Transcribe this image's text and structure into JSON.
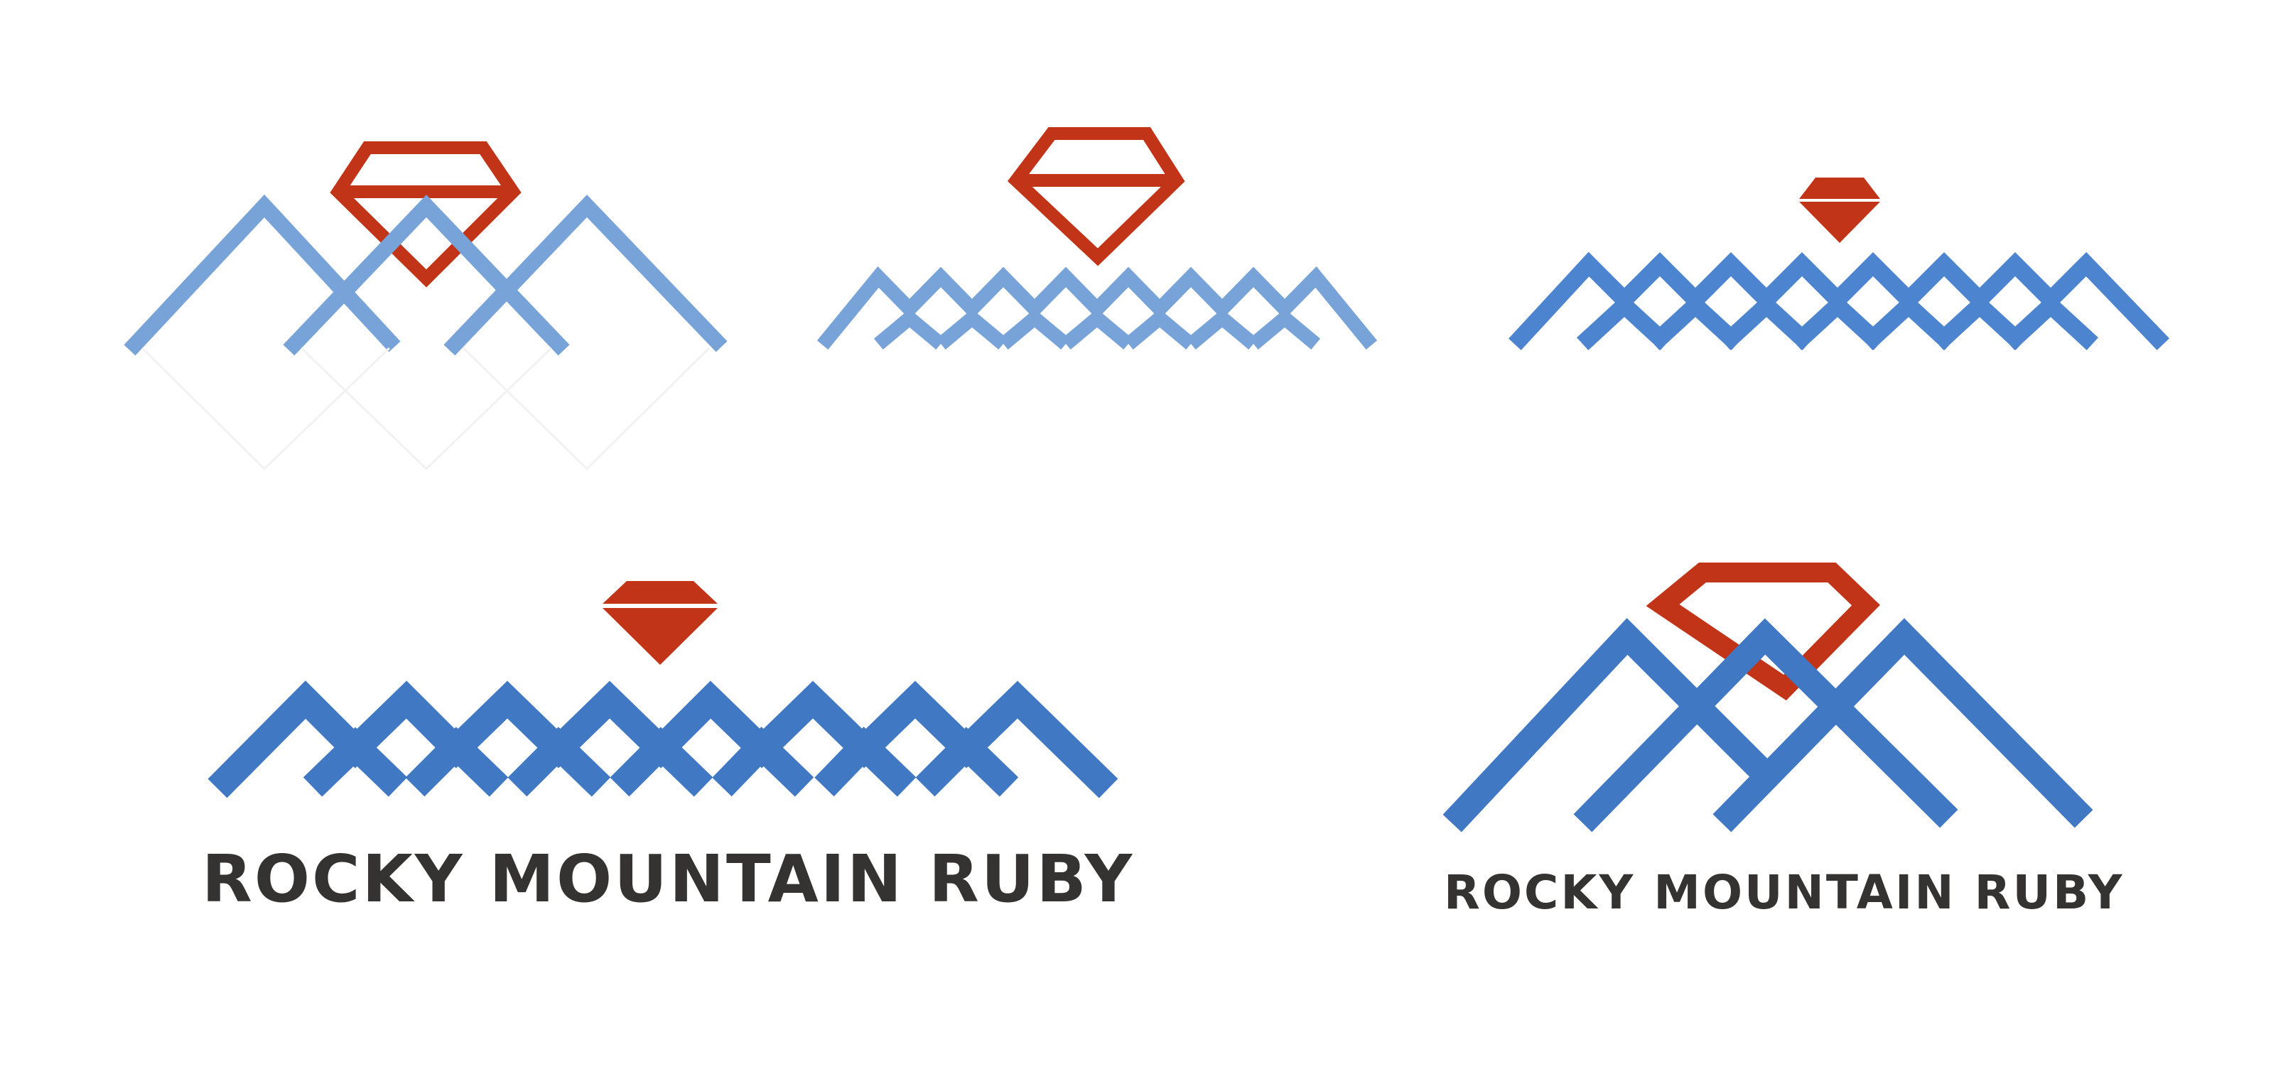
{
  "palette": {
    "ruby_red": "#c23418",
    "blue_light": "#78a3d8",
    "blue_mid": "#4d84cf",
    "blue_deep": "#4078c4",
    "text_dark": "#353331",
    "background": "#ffffff"
  },
  "wordmark_text": "ROCKY MOUNTAIN RUBY",
  "logo_variants": [
    {
      "name": "outline-gem-crossing-peaks",
      "mountain_color": "blue_light",
      "gem_style": "outline"
    },
    {
      "name": "outline-gem-zigzag-peaks",
      "mountain_color": "blue_light",
      "gem_style": "outline"
    },
    {
      "name": "small-solid-gem-zigzag-peaks",
      "mountain_color": "blue_mid",
      "gem_style": "solid"
    },
    {
      "name": "solid-gem-wordmark",
      "mountain_color": "blue_deep",
      "gem_style": "solid",
      "has_wordmark": true
    },
    {
      "name": "outline-gem-tall-peaks-wordmark",
      "mountain_color": "blue_deep",
      "gem_style": "outline",
      "has_wordmark": true
    }
  ]
}
